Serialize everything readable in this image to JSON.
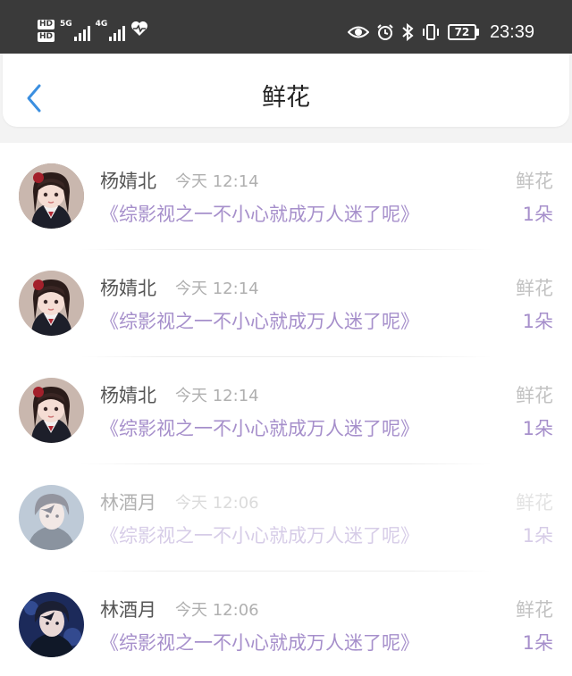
{
  "status_bar": {
    "hd1": "HD",
    "hd2": "HD",
    "net1": "5G",
    "net2": "4G",
    "battery": "72",
    "time": "23:39"
  },
  "header": {
    "title": "鲜花"
  },
  "colors": {
    "accent_blue": "#3b8fe0",
    "book_purple": "#a68fcb",
    "status_bar_bg": "#3a3a3a"
  },
  "records": [
    {
      "name": "杨婧北",
      "time": "今天 12:14",
      "gift": "鲜花",
      "book": "《综影视之一不小心就成万人迷了呢》",
      "count": "1朵",
      "avatar": "girl-avatar-icon"
    },
    {
      "name": "杨婧北",
      "time": "今天 12:14",
      "gift": "鲜花",
      "book": "《综影视之一不小心就成万人迷了呢》",
      "count": "1朵",
      "avatar": "girl-avatar-icon"
    },
    {
      "name": "杨婧北",
      "time": "今天 12:14",
      "gift": "鲜花",
      "book": "《综影视之一不小心就成万人迷了呢》",
      "count": "1朵",
      "avatar": "girl-avatar-icon"
    },
    {
      "name": "林酒月",
      "time": "今天 12:06",
      "gift": "鲜花",
      "book": "《综影视之一不小心就成万人迷了呢》",
      "count": "1朵",
      "avatar": "boy-avatar-icon"
    },
    {
      "name": "林酒月",
      "time": "今天 12:06",
      "gift": "鲜花",
      "book": "《综影视之一不小心就成万人迷了呢》",
      "count": "1朵",
      "avatar": "boy-avatar-icon"
    }
  ]
}
